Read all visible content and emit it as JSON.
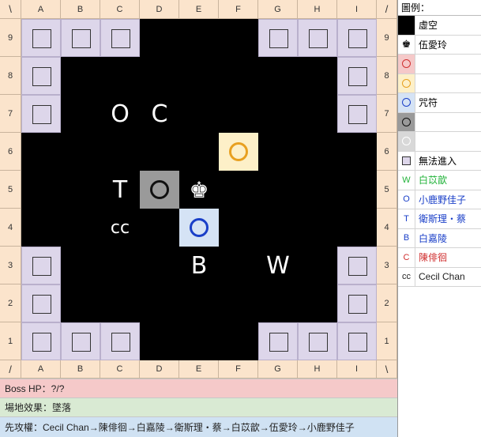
{
  "columns": [
    "A",
    "B",
    "C",
    "D",
    "E",
    "F",
    "G",
    "H",
    "I"
  ],
  "rows": [
    "9",
    "8",
    "7",
    "6",
    "5",
    "4",
    "3",
    "2",
    "1"
  ],
  "corners": {
    "tl": "\\",
    "tr": "/",
    "bl": "/",
    "br": "\\"
  },
  "pieces": [
    {
      "text": "O",
      "col": "C",
      "row": "7",
      "small": false
    },
    {
      "text": "C",
      "col": "D",
      "row": "7",
      "small": false
    },
    {
      "text": "T",
      "col": "C",
      "row": "5",
      "small": false
    },
    {
      "text": "cc",
      "col": "C",
      "row": "4",
      "small": true
    },
    {
      "text": "B",
      "col": "E",
      "row": "3",
      "small": false
    },
    {
      "text": "W",
      "col": "G",
      "row": "3",
      "small": false
    }
  ],
  "king": {
    "symbol": "♚",
    "col": "E",
    "row": "5"
  },
  "markers": [
    {
      "col": "F",
      "row": "6",
      "bg": "#fdf0c8",
      "ring": "#e8a020"
    },
    {
      "col": "D",
      "row": "5",
      "bg": "#9a9a9a",
      "ring": "#111111"
    },
    {
      "col": "E",
      "row": "4",
      "bg": "#d5e3f5",
      "ring": "#1a3fc8"
    }
  ],
  "blocked_cells": [
    "A9",
    "B9",
    "C9",
    "G9",
    "H9",
    "I9",
    "A8",
    "I8",
    "A7",
    "I7",
    "A3",
    "I3",
    "A2",
    "I2",
    "A1",
    "B1",
    "C1",
    "G1",
    "H1",
    "I1"
  ],
  "info": {
    "boss_hp": "Boss HP：?/?",
    "field_effect": "場地效果：墜落",
    "order": "先攻權：Cecil Chan→陳俳徊→白嘉陵→衛斯理・蔡→白苡歆→伍愛玲→小鹿野佳子"
  },
  "info_colors": {
    "boss": "#f5c9c9",
    "field": "#d9ead3",
    "order": "#d0e2f3"
  },
  "legend": {
    "title": "圖例：",
    "void": "虛空",
    "king_label": "伍愛玲",
    "king_symbol": "♚",
    "rings": [
      {
        "bg": "#f5c9c9",
        "color": "#d03030"
      },
      {
        "bg": "#fdf0c8",
        "color": "#e8a020"
      },
      {
        "bg": "#d5e3f5",
        "color": "#1a3fc8"
      },
      {
        "bg": "#9a9a9a",
        "color": "#111111"
      },
      {
        "bg": "#d8d8d8",
        "color": "#ffffff"
      }
    ],
    "ring_label": "咒符",
    "blocked_label": "無法進入",
    "characters": [
      {
        "code": "W",
        "name": "白苡歆",
        "color": "#22b33a"
      },
      {
        "code": "O",
        "name": "小鹿野佳子",
        "color": "#1a3fc8"
      },
      {
        "code": "T",
        "name": "衛斯理・蔡",
        "color": "#1a3fc8"
      },
      {
        "code": "B",
        "name": "白嘉陵",
        "color": "#1a3fc8"
      },
      {
        "code": "C",
        "name": "陳俳徊",
        "color": "#d03030"
      },
      {
        "code": "cc",
        "name": "Cecil Chan",
        "color": "#222222"
      }
    ]
  }
}
